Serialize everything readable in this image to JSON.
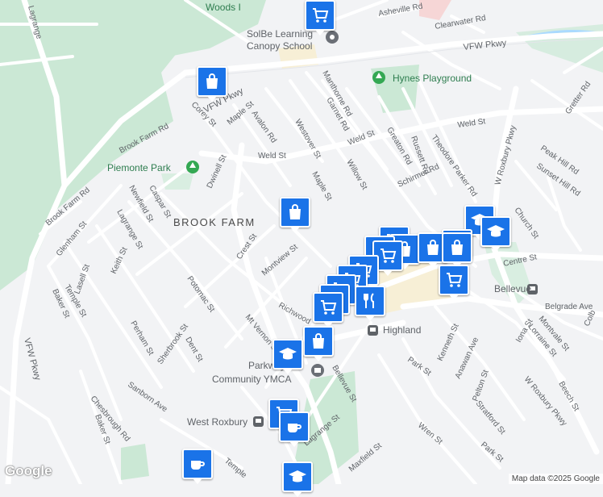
{
  "map": {
    "logo": "Google",
    "attribution": "Map data ©2025 Google",
    "colors": {
      "road": "#ffffff",
      "land": "#f2f3f5",
      "park": "#cbe8d5",
      "water": "#aadaff",
      "pin": "#1a73e8",
      "pin_border": "#ffffff"
    },
    "labels": {
      "woods": "Woods I",
      "solbe": "SolBe Learning",
      "canopy": "Canopy School",
      "hynes": "Hynes Playground",
      "piemonte": "Piemonte Park",
      "brookfarm": "BROOK FARM",
      "parkway_ymca": "Parkway",
      "community_ymca": "Community YMCA",
      "west_roxbury": "West Roxbury",
      "highland": "Highland",
      "bellevue": "Bellevue",
      "vfw_top": "VFW Pkwy",
      "vfw_diag": "VFW Pkwy",
      "vfw_left": "VFW Pkwy",
      "asheville": "Asheville Rd",
      "clearwater": "Clearwater Rd",
      "lagrange_top": "Lagrange",
      "manthorne": "Manthorne Rd",
      "garnet": "Garnet Rd",
      "weld_right": "Weld St",
      "weld_mid": "Weld St",
      "weld_left": "Weld St",
      "greaton": "Greaton Rd",
      "russett": "Russett Rd",
      "theodore": "Theodore Parker Rd",
      "w_roxbury_pkwy_top": "W Roxbury Pkwy",
      "w_roxbury_pkwy_bottom": "W Roxbury Pkwy",
      "gretter": "Gretter Rd",
      "peak_hill": "Peak Hill Rd",
      "sunset_hill": "Sunset Hill Rd",
      "corey": "Corey St",
      "maple_top": "Maple St",
      "avalon": "Avalon Rd",
      "westover": "Westover St",
      "brook_farm_rd": "Brook Farm Rd",
      "dwinell": "Dwinell St",
      "maple_mid": "Maple St",
      "willow": "Willow St",
      "schirmer": "Schirmer Rd",
      "church": "Church St",
      "centre": "Centre St",
      "brook_farm_rd2": "Brook Farm Rd",
      "caspar": "Caspar St",
      "newfield": "Newfield St",
      "lagrange": "Lagrange St",
      "glenham": "Glenham St",
      "keith": "Keith St",
      "lasell": "Lasell St",
      "temple_left": "Temple St",
      "baker_left": "Baker St",
      "crest": "Crest St",
      "montview": "Montview St",
      "potomac": "Potomac St",
      "richwood": "Richwood",
      "mt_vernon": "Mt Vernon St",
      "perham": "Perham St",
      "sherbrook": "Sherbrook St",
      "dent": "Dent St",
      "belgrade": "Belgrade Ave",
      "iona": "Iona St",
      "montvale": "Montvale St",
      "lorraine": "Lorraine St",
      "kenneth": "Kenneth St",
      "anawan": "Anawan Ave",
      "park_mid": "Park St",
      "beech": "Beech St",
      "pelton": "Pelton St",
      "stratford": "Stratford St",
      "bellevue_st": "Bellevue St",
      "wren": "Wren St",
      "park_low": "Park St",
      "maxfield": "Maxfield St",
      "lagrange_low": "Lagrange St",
      "temple_low": "Temple",
      "baker_low": "Baker St",
      "sanborn": "Sanborn Ave",
      "chesbrough": "Chesbrough Rd",
      "colb": "Colb"
    }
  },
  "markers": [
    {
      "id": "m1",
      "icon": "shopping-cart"
    },
    {
      "id": "m2",
      "icon": "shopping-bag"
    },
    {
      "id": "m3",
      "icon": "shopping-bag"
    },
    {
      "id": "m4",
      "icon": "school"
    },
    {
      "id": "m5",
      "icon": "school"
    },
    {
      "id": "m6",
      "icon": "shopping-cart"
    },
    {
      "id": "m7",
      "icon": "shopping-cart"
    },
    {
      "id": "m8",
      "icon": "shopping-bag"
    },
    {
      "id": "m9",
      "icon": "shopping-bag"
    },
    {
      "id": "m10",
      "icon": "shopping-bag"
    },
    {
      "id": "m11",
      "icon": "shopping-cart"
    },
    {
      "id": "m12",
      "icon": "shopping-cart"
    },
    {
      "id": "m13",
      "icon": "shopping-cart"
    },
    {
      "id": "m14",
      "icon": "restaurant"
    },
    {
      "id": "m15",
      "icon": "shopping-cart"
    },
    {
      "id": "m16",
      "icon": "shopping-bag"
    },
    {
      "id": "m17",
      "icon": "school"
    },
    {
      "id": "m18",
      "icon": "shopping-cart"
    },
    {
      "id": "m19",
      "icon": "coffee"
    },
    {
      "id": "m20",
      "icon": "coffee"
    },
    {
      "id": "m21",
      "icon": "school"
    }
  ]
}
